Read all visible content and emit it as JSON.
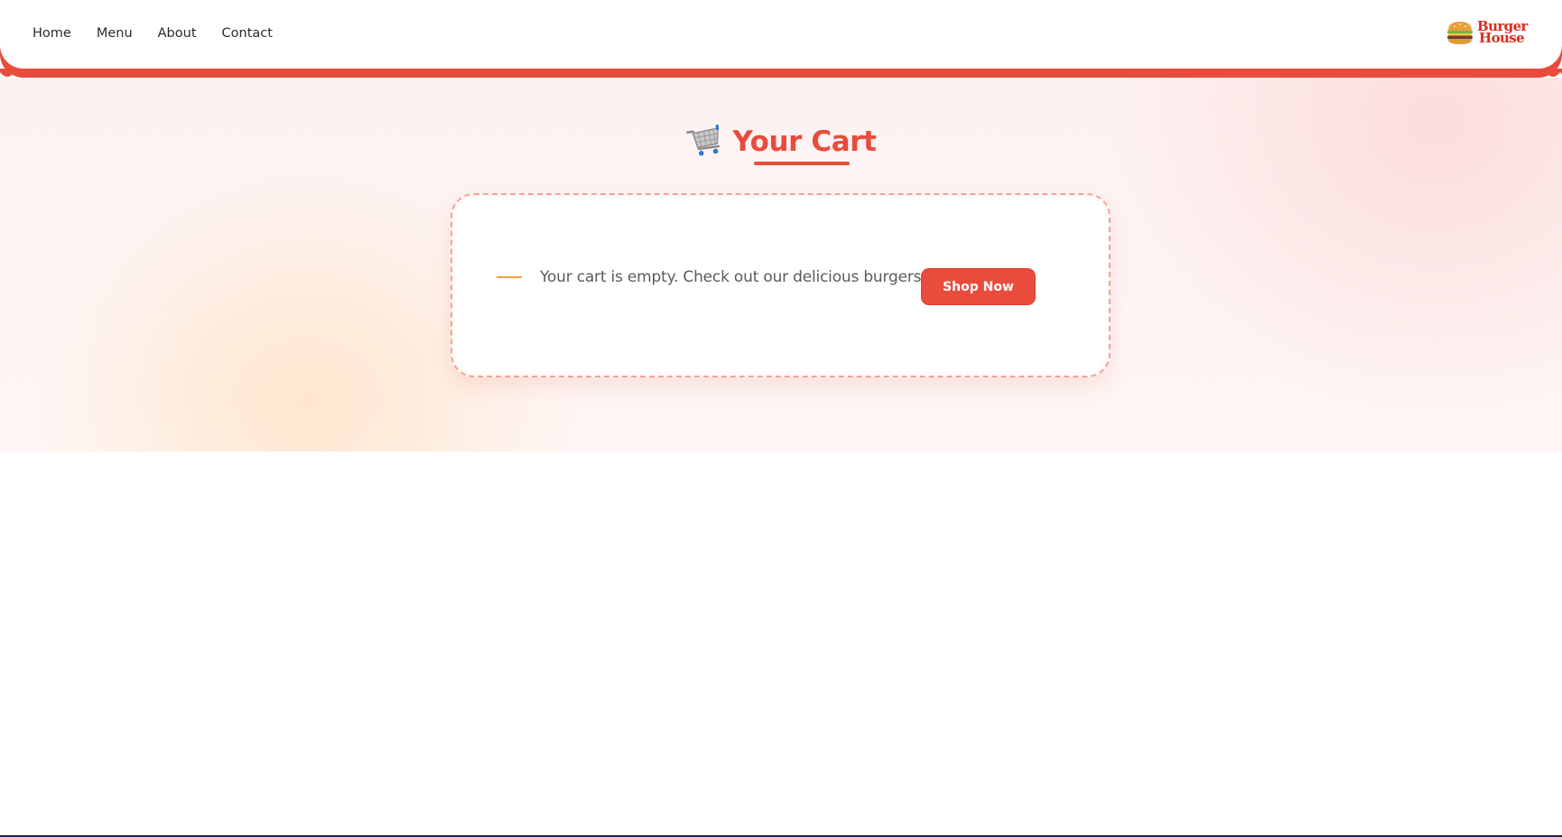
{
  "nav": {
    "items": [
      {
        "label": "Home"
      },
      {
        "label": "Menu"
      },
      {
        "label": "About"
      },
      {
        "label": "Contact"
      }
    ]
  },
  "logo": {
    "line1": "Burger",
    "line2": "House",
    "icon": "burger-icon"
  },
  "cart": {
    "title": "Your Cart",
    "icon": "shopping-cart-icon",
    "empty_message": "Your cart is empty. Check out our delicious burgers!",
    "shop_button": "Shop Now"
  },
  "colors": {
    "brand_red": "#e94c3d",
    "title_red": "#e74c3c",
    "accent_orange": "#f2a03d",
    "logo_red": "#d92e1f"
  }
}
